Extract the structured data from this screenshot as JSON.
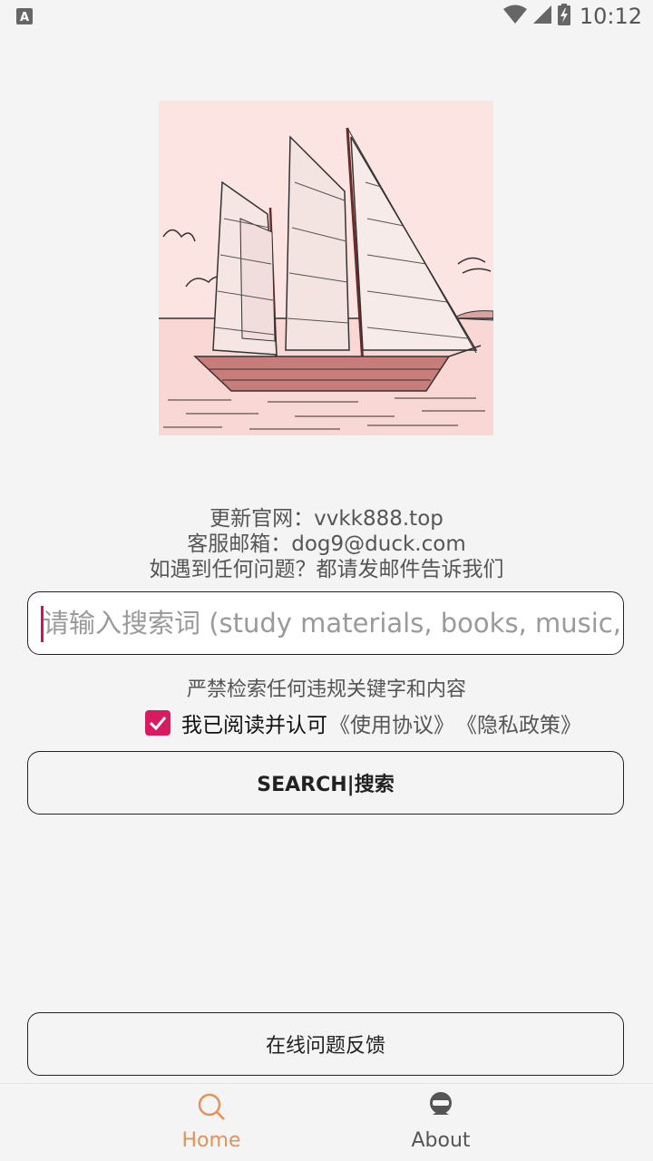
{
  "status_bar": {
    "time": "10:12",
    "left_icon": "a-icon",
    "wifi_icon": "wifi-icon",
    "signal_icon": "signal-icon",
    "battery_icon": "battery-charging-icon"
  },
  "hero": {
    "image_icon": "sailboat-illustration"
  },
  "info": {
    "website": "更新官网：vvkk888.top",
    "email": "客服邮箱：dog9@duck.com",
    "notice": "如遇到任何问题？都请发邮件告诉我们"
  },
  "search": {
    "placeholder": "请输入搜索词 (study materials, books, music, video"
  },
  "warning": "严禁检索任何违规关键字和内容",
  "agreement": {
    "checked": true,
    "text": "我已阅读并认可",
    "terms_link": "《使用协议》",
    "privacy_link": "《隐私政策》"
  },
  "buttons": {
    "search": "SEARCH|搜索",
    "feedback": "在线问题反馈"
  },
  "bottom_nav": {
    "items": [
      {
        "label": "Home",
        "icon": "search-icon",
        "active": true
      },
      {
        "label": "About",
        "icon": "about-icon",
        "active": false
      }
    ]
  },
  "colors": {
    "accent": "#d81b60",
    "nav_active": "#e0935a",
    "background": "#f4f4f4"
  }
}
